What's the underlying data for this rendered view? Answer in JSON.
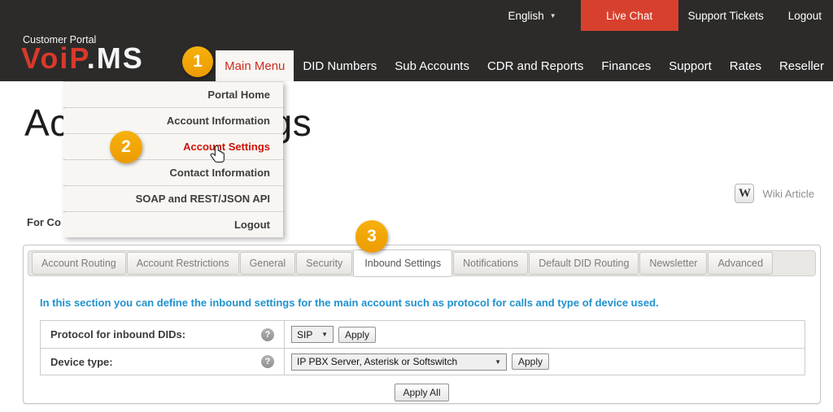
{
  "topbar": {
    "language": "English",
    "live_chat": "Live Chat",
    "support_tickets": "Support Tickets",
    "logout": "Logout"
  },
  "brand": {
    "eyebrow": "Customer Portal",
    "logo_red": "VoiP",
    "logo_white": ".ms"
  },
  "nav": {
    "items": [
      {
        "label": "Main Menu",
        "active": true
      },
      {
        "label": "DID Numbers"
      },
      {
        "label": "Sub Accounts"
      },
      {
        "label": "CDR and Reports"
      },
      {
        "label": "Finances"
      },
      {
        "label": "Support"
      },
      {
        "label": "Rates"
      },
      {
        "label": "Reseller"
      }
    ]
  },
  "menu": {
    "items": [
      {
        "label": "Portal Home"
      },
      {
        "label": "Account Information"
      },
      {
        "label": "Account Settings",
        "active": true
      },
      {
        "label": "Contact Information"
      },
      {
        "label": "SOAP and REST/JSON API"
      },
      {
        "label": "Logout"
      }
    ]
  },
  "page": {
    "title": "Account Settings",
    "intro_fragment": "For Co",
    "wiki_label": "Wiki Article"
  },
  "tabs": {
    "active": "Inbound Settings",
    "items": [
      {
        "label": "Account Routing"
      },
      {
        "label": "Account Restrictions"
      },
      {
        "label": "General"
      },
      {
        "label": "Security"
      },
      {
        "label": "Inbound Settings",
        "active": true
      },
      {
        "label": "Notifications"
      },
      {
        "label": "Default DID Routing"
      },
      {
        "label": "Newsletter"
      },
      {
        "label": "Advanced"
      }
    ]
  },
  "panel": {
    "description": "In this section you can define the inbound settings for the main account such as protocol for calls and type of device used.",
    "rows": [
      {
        "label": "Protocol for inbound DIDs:",
        "value": "SIP",
        "apply": "Apply"
      },
      {
        "label": "Device type:",
        "value": "IP PBX Server, Asterisk or Softswitch",
        "apply": "Apply"
      }
    ],
    "apply_all": "Apply All"
  },
  "badges": {
    "step1": "1",
    "step2": "2",
    "step3": "3"
  },
  "icons": {
    "caret_down": "▼",
    "help": "?",
    "wiki_w": "W"
  },
  "colors": {
    "header_dark": "#2c2b2a",
    "brand_red": "#d8392b",
    "live_chat_red": "#d8402e",
    "menu_active_red": "#cc1408",
    "info_blue": "#2192cc",
    "badge_orange": "#f0a30a"
  }
}
